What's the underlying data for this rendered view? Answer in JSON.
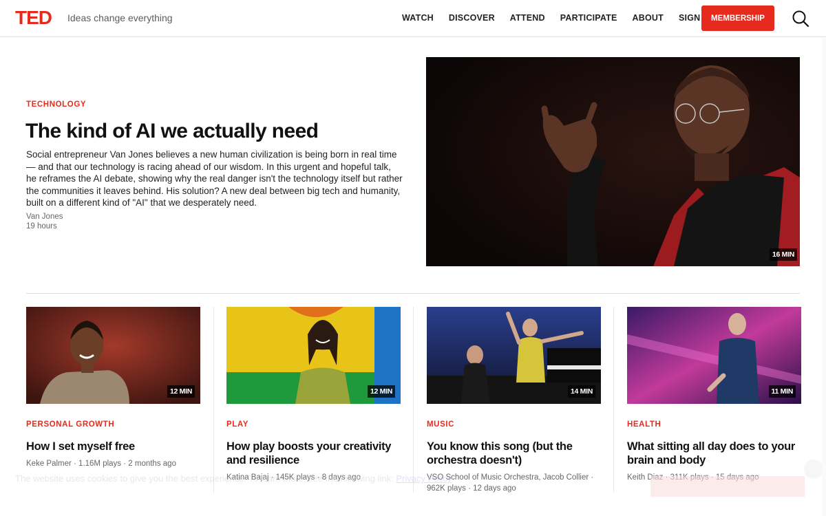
{
  "header": {
    "logo": "TED",
    "tagline": "Ideas change everything",
    "nav": [
      "WATCH",
      "DISCOVER",
      "ATTEND",
      "PARTICIPATE",
      "ABOUT",
      "SIGN IN"
    ],
    "membership_label": "Membership",
    "search_icon": "search-icon"
  },
  "colors": {
    "brand_red": "#e62b1e",
    "text": "#111111",
    "muted": "#666666"
  },
  "hero": {
    "topic": "TECHNOLOGY",
    "title": "The kind of AI we actually need",
    "description": "Social entrepreneur Van Jones believes a new human civilization is being born in real time — and that our technology is racing ahead of our wisdom. In this urgent and hopeful talk, he reframes the AI debate, showing why the real danger isn't the technology itself but rather the communities it leaves behind. His solution? A new deal between big tech and humanity, built on a different kind of \"AI\" that we desperately need.",
    "author": "Van Jones",
    "posted": "19 hours",
    "duration": "16 MIN"
  },
  "talks": [
    {
      "topic": "PERSONAL GROWTH",
      "title": "How I set myself free",
      "meta": "Keke Palmer · 1.16M plays · 2 months ago",
      "duration": "12 MIN"
    },
    {
      "topic": "PLAY",
      "title": "How play boosts your creativity and resilience",
      "meta": "Katina Bajaj · 145K plays · 8 days ago",
      "duration": "12 MIN"
    },
    {
      "topic": "MUSIC",
      "title": "You know this song (but the orchestra doesn't)",
      "meta": "VSO School of Music Orchestra, Jacob Collier · 962K plays · 12 days ago",
      "duration": "14 MIN"
    },
    {
      "topic": "HEALTH",
      "title": "What sitting all day does to your brain and body",
      "meta": "Keith Diaz · 311K plays · 15 days ago",
      "duration": "11 MIN"
    }
  ],
  "cookie": {
    "text": "The website uses cookies to give you the best experience. To learn more, see the following link:",
    "link": "Privacy Policy"
  }
}
